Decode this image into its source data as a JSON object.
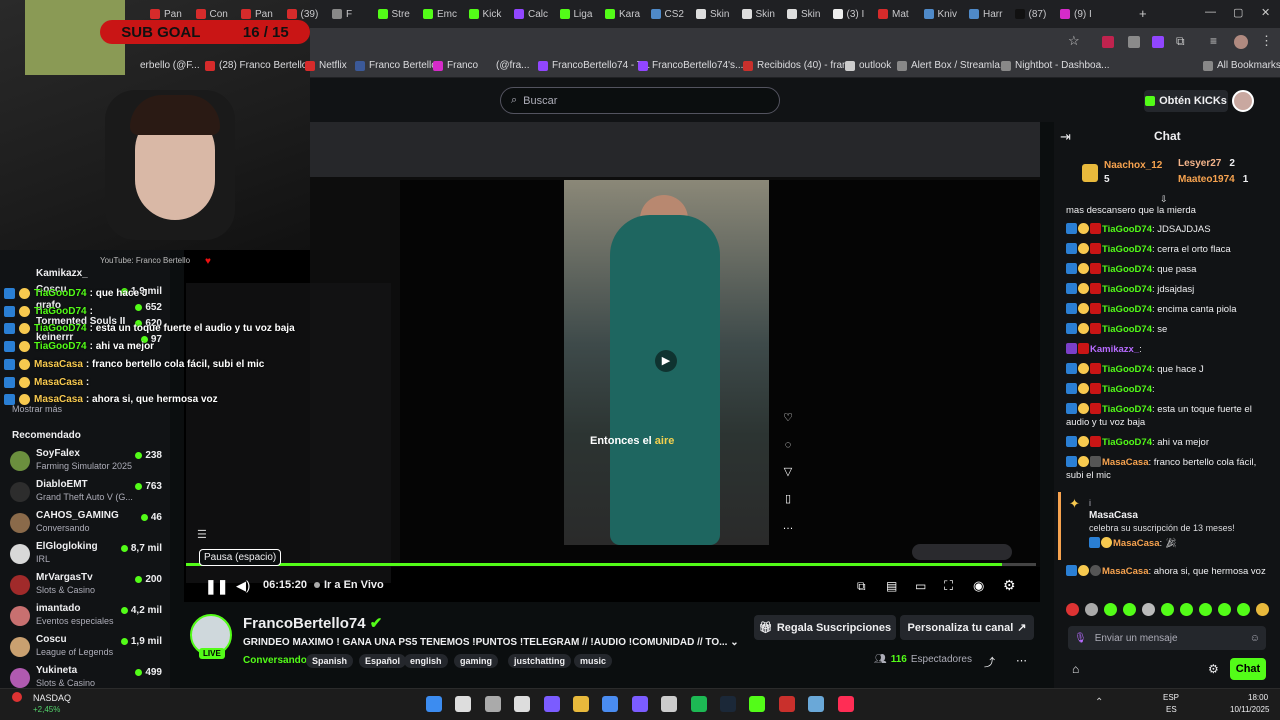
{
  "browser": {
    "tabs": [
      "Pan",
      "Con",
      "Pan",
      "(39)",
      "F",
      "Stre",
      "Emc",
      "Kick",
      "Calc",
      "Liga",
      "Kara",
      "CS2",
      "Skin",
      "Skin",
      "Skin",
      "(3) I",
      "Mat",
      "Kniv",
      "Harr",
      "(87)",
      "(9) I"
    ],
    "bookmarks": [
      "erbello (@F...",
      "(28) Franco Bertello...",
      "Netflix",
      "Franco Bertello",
      "Franco",
      "(@fra...",
      "FrancoBertello74 - T...",
      "FrancoBertello74's...",
      "Recibidos (40) - fran...",
      "outlook",
      "Alert Box / Streamla...",
      "Nightbot - Dashboa...",
      "All Bookmarks"
    ]
  },
  "overlay": {
    "sub_goal_label": "SUB GOAL",
    "sub_goal_value": "16 / 15",
    "webcam_caption": "YouTube: Franco Bertello",
    "chat_lines": [
      {
        "user": "TiaGooD74",
        "text": ": que hace J"
      },
      {
        "user": "TiaGooD74",
        "text": ":"
      },
      {
        "user": "TiaGooD74",
        "text": ": esta un toque fuerte el audio y tu voz baja"
      },
      {
        "user": "TiaGooD74",
        "text": ": ahi va mejor"
      },
      {
        "user": "MasaCasa",
        "text": ": franco bertello cola fácil, subi el mic"
      },
      {
        "user": "MasaCasa",
        "text": ":"
      },
      {
        "user": "MasaCasa",
        "text": ": ahora si, que hermosa voz"
      }
    ]
  },
  "header": {
    "search_placeholder": "Buscar",
    "kicks_label": "Obtén KICKs"
  },
  "sidebar": {
    "peek_items": [
      {
        "name": "Kamikazx_",
        "viewers": ""
      },
      {
        "name": "Coscu",
        "viewers": "1,9 mil"
      },
      {
        "name": "grafo",
        "viewers": "652"
      },
      {
        "name": "Tormented Souls II",
        "viewers": "620"
      },
      {
        "name": "keinerrr",
        "viewers": "97"
      }
    ],
    "show_more": "Mostrar más",
    "recommended_title": "Recomendado",
    "recommended": [
      {
        "name": "SoyFalex",
        "category": "Farming Simulator 2025",
        "viewers": "238",
        "color": "#6b8f3e"
      },
      {
        "name": "DiabloEMT",
        "category": "Grand Theft Auto V (G...",
        "viewers": "763",
        "color": "#2d2d2d"
      },
      {
        "name": "CAHOS_GAMING",
        "category": "Conversando",
        "viewers": "46",
        "color": "#8a6a4a"
      },
      {
        "name": "ElGlogloking",
        "category": "IRL",
        "viewers": "8,7 mil",
        "color": "#d8d8d8"
      },
      {
        "name": "MrVargasTv",
        "category": "Slots & Casino",
        "viewers": "200",
        "color": "#a02a2a"
      },
      {
        "name": "imantado",
        "category": "Eventos especiales",
        "viewers": "4,2 mil",
        "color": "#c87070"
      },
      {
        "name": "Coscu",
        "category": "League of Legends",
        "viewers": "1,9 mil",
        "color": "#c9a070"
      },
      {
        "name": "Yukineta",
        "category": "Slots & Casino",
        "viewers": "499",
        "color": "#b05ab0"
      }
    ]
  },
  "video": {
    "caption_pre": "Entonces el ",
    "caption_hl": "aire",
    "tooltip": "Pausa (espacio)",
    "timecode": "06:15:20",
    "go_live": "Ir a En Vivo",
    "progress": 0.96
  },
  "channel": {
    "name": "FrancoBertello74",
    "live_badge": "LIVE",
    "title": "GRINDEO MAXIMO ! GANA UNA PS5 TENEMOS !PUNTOS !TELEGRAM // !AUDIO !COMUNIDAD // TO...",
    "category": "Conversando",
    "tags": [
      "Spanish",
      "Español",
      "english",
      "gaming",
      "justchatting",
      "music"
    ],
    "gift_subs": "Regala Suscripciones",
    "customize": "Personaliza tu canal",
    "viewers": "116",
    "viewers_label": "Espectadores"
  },
  "chat": {
    "title": "Chat",
    "leaderboard": [
      {
        "name": "Naachox_12",
        "count": "5"
      },
      {
        "name": "Lesyer27",
        "count": "2"
      },
      {
        "name": "Maateo1974",
        "count": "1"
      }
    ],
    "messages": [
      {
        "user": "",
        "text": "mas descansero que la mierda",
        "cls": ""
      },
      {
        "user": "TiaGooD74",
        "text": ": JDSAJDJAS",
        "cls": "u"
      },
      {
        "user": "TiaGooD74",
        "text": ": cerra el orto flaca",
        "cls": "u"
      },
      {
        "user": "TiaGooD74",
        "text": ": que pasa",
        "cls": "u"
      },
      {
        "user": "TiaGooD74",
        "text": ": jdsajdasj",
        "cls": "u"
      },
      {
        "user": "TiaGooD74",
        "text": ": encima canta piola",
        "cls": "u"
      },
      {
        "user": "TiaGooD74",
        "text": ": se",
        "cls": "u"
      },
      {
        "user": "Kamikazx_",
        "text": ":",
        "cls": "u3"
      },
      {
        "user": "TiaGooD74",
        "text": ": que hace J",
        "cls": "u"
      },
      {
        "user": "TiaGooD74",
        "text": ":",
        "cls": "u"
      },
      {
        "user": "TiaGooD74",
        "text": ": esta un toque fuerte el audio y tu voz baja",
        "cls": "u"
      },
      {
        "user": "TiaGooD74",
        "text": ": ahi va mejor",
        "cls": "u"
      },
      {
        "user": "MasaCasa",
        "text": ": franco bertello cola fácil, subi el mic",
        "cls": "u2"
      }
    ],
    "sub_card": {
      "marker": "i",
      "user": "MasaCasa",
      "text": "celebra su suscripción de 13 meses!",
      "line_user": "MasaCasa",
      "line_text": ":"
    },
    "last": {
      "user": "MasaCasa",
      "text": ": ahora si, que hermosa voz"
    },
    "input_placeholder": "Enviar un mensaje",
    "send_label": "Chat"
  },
  "taskbar": {
    "ticker_name": "NASDAQ",
    "ticker_change": "+2,45%",
    "lang": "ESP",
    "lang2": "ES",
    "time": "18:00",
    "date": "10/11/2025"
  },
  "colors": {
    "kick_green": "#53fc18",
    "bg": "#0b0e0f",
    "panel": "#111315"
  }
}
